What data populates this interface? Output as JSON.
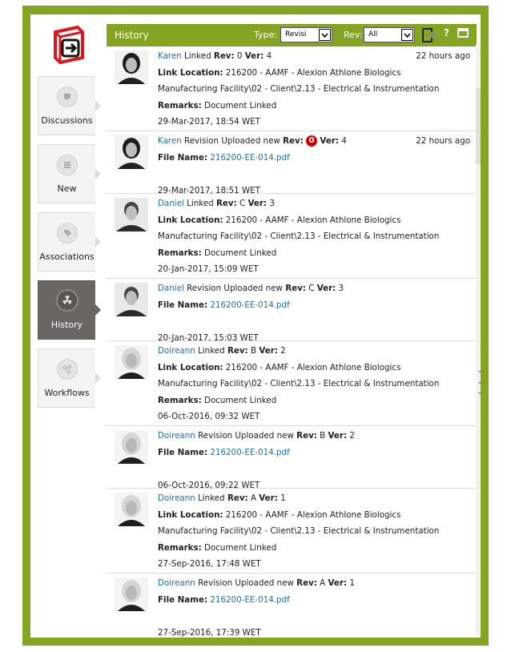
{
  "nav": {
    "items": [
      {
        "label": "Discussions",
        "icon": "chat-bubble-icon"
      },
      {
        "label": "New",
        "icon": "list-icon"
      },
      {
        "label": "Associations",
        "icon": "tag-icon"
      },
      {
        "label": "History",
        "icon": "radiation-icon",
        "active": true
      },
      {
        "label": "Workflows",
        "icon": "workflow-icon"
      }
    ]
  },
  "panel": {
    "title": "History",
    "type_label": "Type:",
    "type_value": "Revisi",
    "rev_label": "Rev:",
    "rev_value": "All",
    "help": "?"
  },
  "entries": [
    {
      "user": "Karen",
      "action": " Linked ",
      "rev_label": "Rev:",
      "rev": " 0 ",
      "ver_label": "Ver:",
      "ver": " 4",
      "time_ago": "22 hours ago",
      "link_label": "Link Location:",
      "link_value": " 216200 - AAMF - Alexion Athlone Biologics",
      "link_value2": "Manufacturing Facility\\02 - Client\\2.13 - Electrical & Instrumentation",
      "remarks_label": "Remarks:",
      "remarks_value": " Document Linked",
      "date": "29-Mar-2017, 18:54 WET"
    },
    {
      "user": "Karen",
      "action": " Revision Uploaded new ",
      "rev_label": "Rev:",
      "rev_badge": "0",
      "ver_label": "Ver:",
      "ver": " 4",
      "time_ago": "22 hours ago",
      "file_label": "File Name:",
      "file_value": "216200-EE-014.pdf",
      "date": "29-Mar-2017, 18:51 WET"
    },
    {
      "user": "Daniel",
      "action": " Linked ",
      "rev_label": "Rev:",
      "rev": " C ",
      "ver_label": "Ver:",
      "ver": " 3",
      "link_label": "Link Location:",
      "link_value": " 216200 - AAMF - Alexion Athlone Biologics",
      "link_value2": "Manufacturing Facility\\02 - Client\\2.13 - Electrical & Instrumentation",
      "remarks_label": "Remarks:",
      "remarks_value": " Document Linked",
      "date": "20-Jan-2017, 15:09 WET"
    },
    {
      "user": "Daniel",
      "action": " Revision Uploaded new ",
      "rev_label": "Rev:",
      "rev": " C ",
      "ver_label": "Ver:",
      "ver": " 3",
      "file_label": "File Name:",
      "file_value": "216200-EE-014.pdf",
      "date": "20-Jan-2017, 15:03 WET"
    },
    {
      "user": "Doireann",
      "action": " Linked ",
      "rev_label": "Rev:",
      "rev": " B ",
      "ver_label": "Ver:",
      "ver": " 2",
      "link_label": "Link Location:",
      "link_value": " 216200 - AAMF - Alexion Athlone Biologics",
      "link_value2": "Manufacturing Facility\\02 - Client\\2.13 - Electrical & Instrumentation",
      "remarks_label": "Remarks:",
      "remarks_value": " Document Linked",
      "date": "06-Oct-2016, 09:32 WET"
    },
    {
      "user": "Doireann",
      "action": " Revision Uploaded new ",
      "rev_label": "Rev:",
      "rev": " B ",
      "ver_label": "Ver:",
      "ver": " 2",
      "file_label": "File Name:",
      "file_value": "216200-EE-014.pdf",
      "date": "06-Oct-2016, 09:22 WET"
    },
    {
      "user": "Doireann",
      "action": " Linked ",
      "rev_label": "Rev:",
      "rev": " A ",
      "ver_label": "Ver:",
      "ver": " 1",
      "link_label": "Link Location:",
      "link_value": " 216200 - AAMF - Alexion Athlone Biologics",
      "link_value2": "Manufacturing Facility\\02 - Client\\2.13 - Electrical & Instrumentation",
      "remarks_label": "Remarks:",
      "remarks_value": " Document Linked",
      "date": "27-Sep-2016, 17:48 WET"
    },
    {
      "user": "Doireann",
      "action": " Revision Uploaded new ",
      "rev_label": "Rev:",
      "rev": " A ",
      "ver_label": "Ver:",
      "ver": " 1",
      "file_label": "File Name:",
      "file_value": "216200-EE-014.pdf",
      "date": "27-Sep-2016, 17:39 WET"
    }
  ],
  "colors": {
    "brand_green": "#84a521",
    "link_blue": "#1a6fb8",
    "badge_red": "#cc0000",
    "logo_red": "#d9181f"
  }
}
